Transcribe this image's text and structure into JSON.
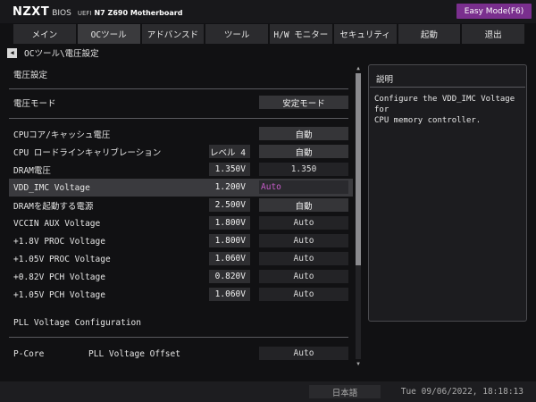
{
  "header": {
    "brand": "NZXT",
    "bios": "BIOS",
    "uefi": "UEFI",
    "model": "N7 Z690 Motherboard",
    "easy_mode": "Easy Mode(F6)"
  },
  "tabs": [
    {
      "label": "メイン"
    },
    {
      "label": "OCツール"
    },
    {
      "label": "アドバンスド"
    },
    {
      "label": "ツール"
    },
    {
      "label": "H/W モニター"
    },
    {
      "label": "セキュリティ"
    },
    {
      "label": "起動"
    },
    {
      "label": "退出"
    }
  ],
  "breadcrumb": "OCツール\\電圧設定",
  "main": {
    "section_title": "電圧設定",
    "voltage_mode": {
      "label": "電圧モード",
      "value": "安定モード"
    },
    "rows": [
      {
        "label": "CPUコア/キャッシュ電圧",
        "current": "",
        "value": "自動"
      },
      {
        "label": "CPU ロードラインキャリブレーション",
        "current": "レベル 4",
        "value": "自動"
      },
      {
        "label": "DRAM電圧",
        "current": "1.350V",
        "value": "1.350"
      },
      {
        "label": "VDD_IMC Voltage",
        "current": "1.200V",
        "value": "Auto"
      },
      {
        "label": "DRAMを起動する電源",
        "current": "2.500V",
        "value": "自動"
      },
      {
        "label": "VCCIN AUX Voltage",
        "current": "1.800V",
        "value": "Auto"
      },
      {
        "label": "+1.8V PROC Voltage",
        "current": "1.800V",
        "value": "Auto"
      },
      {
        "label": "+1.05V PROC Voltage",
        "current": "1.060V",
        "value": "Auto"
      },
      {
        "label": "+0.82V PCH Voltage",
        "current": "0.820V",
        "value": "Auto"
      },
      {
        "label": "+1.05V PCH Voltage",
        "current": "1.060V",
        "value": "Auto"
      }
    ],
    "pll_title": "PLL Voltage Configuration",
    "pll_row": {
      "label": "P-Core",
      "label2": "PLL Voltage Offset",
      "value": "Auto"
    }
  },
  "help": {
    "title": "説明",
    "text": "Configure the VDD_IMC Voltage for\nCPU memory controller."
  },
  "status": {
    "language": "日本語",
    "datetime": "Tue 09/06/2022, 18:18:13"
  },
  "colors": {
    "accent": "#7a2f8e",
    "edit_text": "#c75cc9",
    "background": "#111113"
  }
}
